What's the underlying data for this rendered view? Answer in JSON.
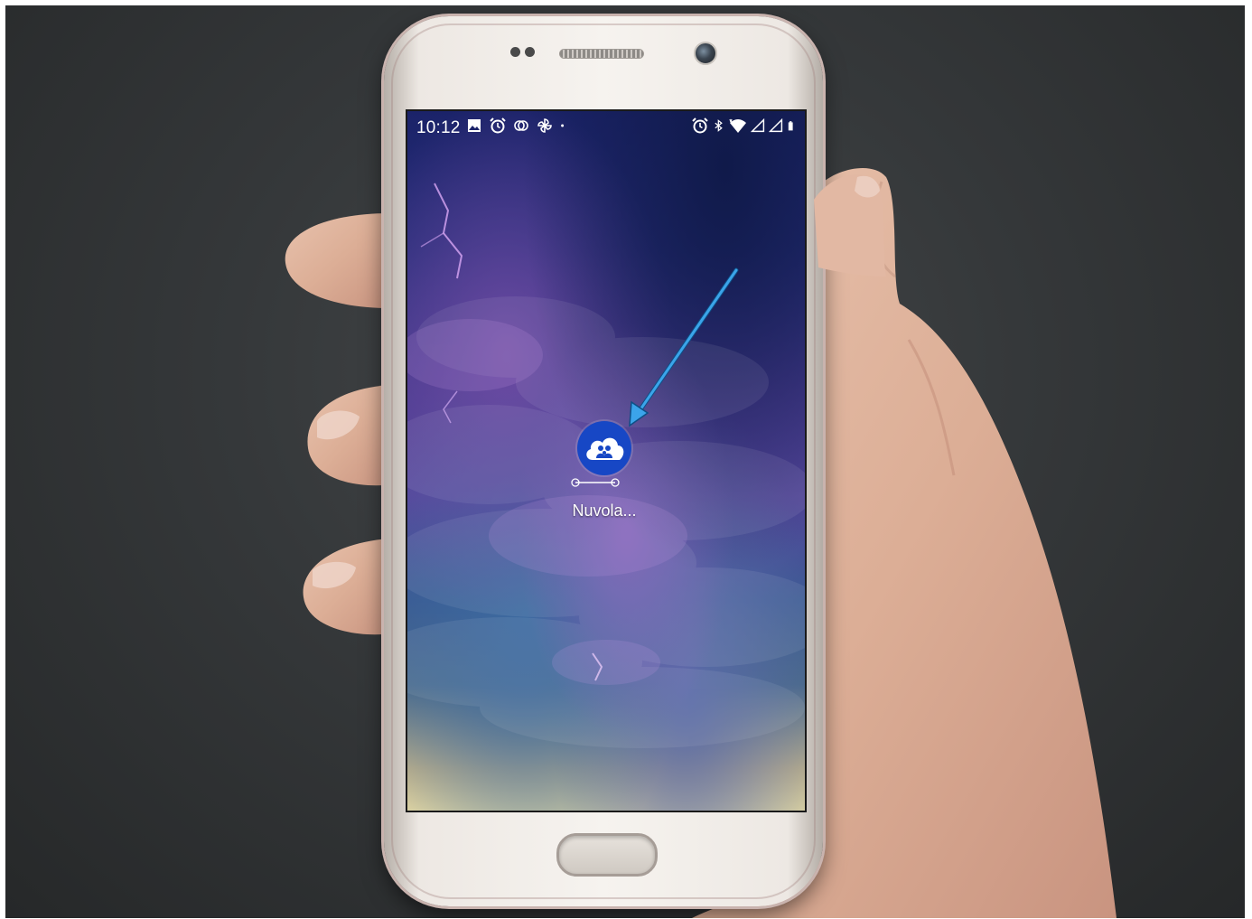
{
  "statusbar": {
    "time": "10:12",
    "left_icons": [
      "gallery-icon",
      "alarm-icon",
      "sync-icon",
      "pinwheel-icon",
      "dot-icon"
    ],
    "right_icons": [
      "alarm-icon",
      "bluetooth-icon",
      "wifi-icon",
      "signal-icon",
      "signal-icon",
      "battery-icon"
    ]
  },
  "home_screen": {
    "app": {
      "label": "Nuvola...",
      "icon": "cloud-family-icon",
      "icon_color": "#1747c5"
    }
  },
  "annotation": {
    "arrow_color": "#3ba4ea"
  }
}
